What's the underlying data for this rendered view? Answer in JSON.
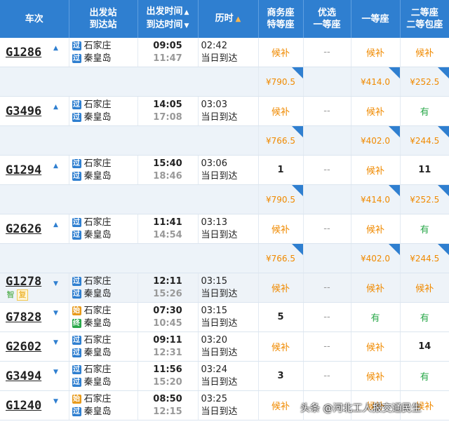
{
  "headers": {
    "train_no": "车次",
    "stations": [
      "出发站",
      "到达站"
    ],
    "times": [
      "出发时间",
      "到达时间"
    ],
    "duration": "历时",
    "business": [
      "商务座",
      "特等座"
    ],
    "premium_first": [
      "优选",
      "一等座"
    ],
    "first": "一等座",
    "second": [
      "二等座",
      "二等包座"
    ],
    "asc_arrow": "▲",
    "desc_arrow": "▼"
  },
  "badges": {
    "pass": "过",
    "start": "始",
    "end": "终"
  },
  "rows": [
    {
      "no": "G1286",
      "dir": "▲",
      "from_badge": "过",
      "from": "石家庄",
      "to_badge": "过",
      "to": "秦皇岛",
      "dep": "09:05",
      "arr": "11:47",
      "dur": "02:42",
      "day": "当日到达",
      "business": "候补",
      "premium": "--",
      "first": "候补",
      "second": "候补",
      "prices": {
        "business": "¥790.5",
        "first": "¥414.0",
        "second": "¥252.5"
      }
    },
    {
      "no": "G3496",
      "dir": "▲",
      "from_badge": "过",
      "from": "石家庄",
      "to_badge": "过",
      "to": "秦皇岛",
      "dep": "14:05",
      "arr": "17:08",
      "dur": "03:03",
      "day": "当日到达",
      "business": "候补",
      "premium": "--",
      "first": "候补",
      "second": "有",
      "prices": {
        "business": "¥766.5",
        "first": "¥402.0",
        "second": "¥244.5"
      }
    },
    {
      "no": "G1294",
      "dir": "▲",
      "from_badge": "过",
      "from": "石家庄",
      "to_badge": "过",
      "to": "秦皇岛",
      "dep": "15:40",
      "arr": "18:46",
      "dur": "03:06",
      "day": "当日到达",
      "business": "1",
      "premium": "--",
      "first": "候补",
      "second": "11",
      "prices": {
        "business": "¥790.5",
        "first": "¥414.0",
        "second": "¥252.5"
      }
    },
    {
      "no": "G2626",
      "dir": "▲",
      "from_badge": "过",
      "from": "石家庄",
      "to_badge": "过",
      "to": "秦皇岛",
      "dep": "11:41",
      "arr": "14:54",
      "dur": "03:13",
      "day": "当日到达",
      "business": "候补",
      "premium": "--",
      "first": "候补",
      "second": "有",
      "prices": {
        "business": "¥766.5",
        "first": "¥402.0",
        "second": "¥244.5"
      }
    }
  ],
  "rows2": [
    {
      "no": "G1278",
      "dir": "▼",
      "tags": [
        "智",
        "复"
      ],
      "from_badge": "过",
      "from": "石家庄",
      "to_badge": "过",
      "to": "秦皇岛",
      "dep": "12:11",
      "arr": "15:26",
      "dur": "03:15",
      "day": "当日到达",
      "business": "候补",
      "premium": "--",
      "first": "候补",
      "second": "候补"
    },
    {
      "no": "G7828",
      "dir": "▼",
      "from_badge": "始",
      "from": "石家庄",
      "to_badge": "终",
      "to": "秦皇岛",
      "dep": "07:30",
      "arr": "10:45",
      "dur": "03:15",
      "day": "当日到达",
      "business": "5",
      "premium": "--",
      "first": "有",
      "second": "有"
    },
    {
      "no": "G2602",
      "dir": "▼",
      "from_badge": "过",
      "from": "石家庄",
      "to_badge": "过",
      "to": "秦皇岛",
      "dep": "09:11",
      "arr": "12:31",
      "dur": "03:20",
      "day": "当日到达",
      "business": "候补",
      "premium": "--",
      "first": "候补",
      "second": "14"
    },
    {
      "no": "G3494",
      "dir": "▼",
      "from_badge": "过",
      "from": "石家庄",
      "to_badge": "过",
      "to": "秦皇岛",
      "dep": "11:56",
      "arr": "15:20",
      "dur": "03:24",
      "day": "当日到达",
      "business": "3",
      "premium": "--",
      "first": "候补",
      "second": "有"
    },
    {
      "no": "G1240",
      "dir": "▼",
      "from_badge": "始",
      "from": "石家庄",
      "to_badge": "过",
      "to": "秦皇岛",
      "dep": "08:50",
      "arr": "12:15",
      "dur": "03:25",
      "day": "当日到达",
      "business": "候补",
      "premium": "--",
      "first": "候补",
      "second": "候补"
    }
  ],
  "watermark": "头条 @河北工人报交通民生",
  "colors": {
    "header_bg": "#2f7fd0",
    "waitlist": "#f08a00",
    "available": "#2aa84a"
  }
}
